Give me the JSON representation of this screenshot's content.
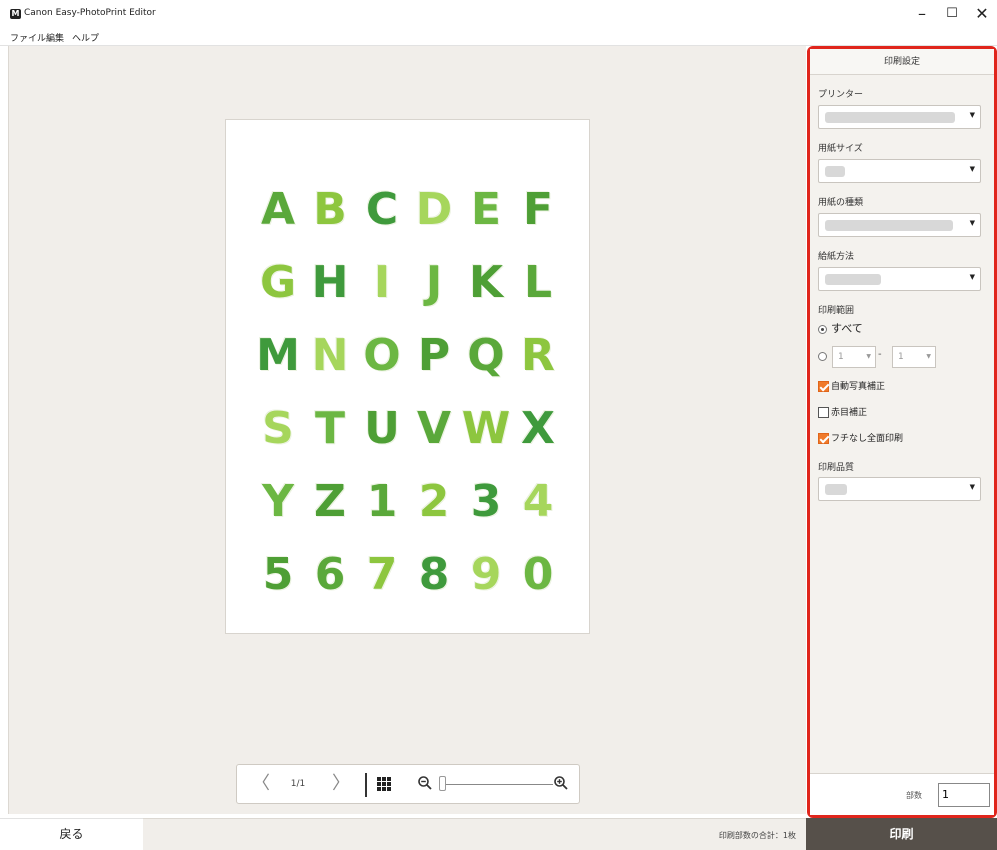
{
  "window": {
    "title": "Canon Easy-PhotoPrint Editor",
    "logo_text": "M",
    "minimize": "–",
    "maximize": "☐",
    "close": "✕"
  },
  "menu": {
    "items": [
      "ファイル",
      "編集",
      "ヘルプ"
    ]
  },
  "preview": {
    "letters": [
      [
        "A",
        "B",
        "C",
        "D",
        "E",
        "F"
      ],
      [
        "G",
        "H",
        "I",
        "J",
        "K",
        "L"
      ],
      [
        "M",
        "N",
        "O",
        "P",
        "Q",
        "R"
      ],
      [
        "S",
        "T",
        "U",
        "V",
        "W",
        "X"
      ],
      [
        "Y",
        "Z",
        "1",
        "2",
        "3",
        "4"
      ],
      [
        "5",
        "6",
        "7",
        "8",
        "9",
        "0"
      ]
    ],
    "colors": [
      "#5aa83a",
      "#8dc63f",
      "#3f9a3c",
      "#a6d65c",
      "#6cb743",
      "#4e9f35"
    ]
  },
  "navigation": {
    "prev": "〈",
    "page": "1/1",
    "next": "〉",
    "zoom_out_icon": "magnifier-minus",
    "zoom_in_icon": "magnifier-plus",
    "zoom_level": 0.02
  },
  "panel": {
    "title": "印刷設定",
    "printer_label": "プリンター",
    "paper_size_label": "用紙サイズ",
    "media_type_label": "用紙の種類",
    "paper_source_label": "給紙方法",
    "print_range_label": "印刷範囲",
    "range_all": "すべて",
    "range_from": "1",
    "range_to": "1",
    "range_dash": "-",
    "auto_correct": "自動写真補正",
    "red_eye": "赤目補正",
    "borderless": "フチなし全面印刷",
    "print_quality_label": "印刷品質",
    "copies_label": "部数",
    "copies_value": "1"
  },
  "footer": {
    "back": "戻る",
    "status": "印刷部数の合計：1枚",
    "print": "印刷"
  },
  "accent": {
    "highlight_border": "#e0251c",
    "checkbox": "#f07a2a",
    "print_button": "#56504a"
  }
}
